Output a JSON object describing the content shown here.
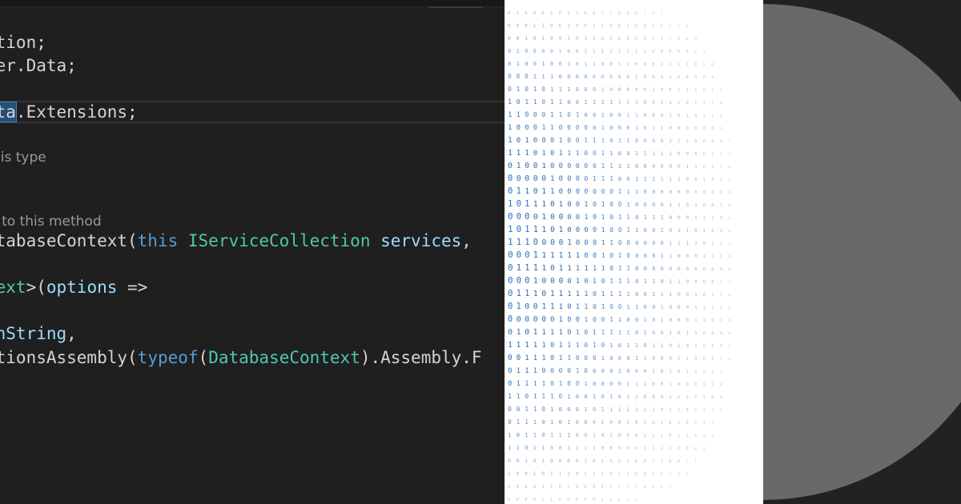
{
  "editor": {
    "lines": {
      "l1": "ction;",
      "l2": "mer.Data;",
      "l3_sel": "ata",
      "l3_rest": ".Extensions;",
      "l6_a": "atabaseContext(",
      "l6_this": "this",
      "l6_type": "IServiceCollection",
      "l6_param": "services",
      "l6_end": ",",
      "l8_type": "text",
      "l8_a": ">(",
      "l8_param": "options",
      "l8_arrow": " =>",
      "l10_member": "onString",
      "l10_end": ",",
      "l11_member": "ationsAssembly",
      "l11_p1": "(",
      "l11_typeof": "typeof",
      "l11_p2": "(",
      "l11_type": "DatabaseContext",
      "l11_rest": ").Assembly.F"
    },
    "hints": {
      "type_hint": "his type",
      "method_hint": "t to this method"
    }
  },
  "colors": {
    "keyword": "#569cd6",
    "type": "#4ec9b0",
    "parameter": "#9cdcfe",
    "text": "#d4d4d4",
    "background": "#1f1f1f",
    "binary_digits": "#2a6fb8",
    "decor_circle": "#696969"
  }
}
